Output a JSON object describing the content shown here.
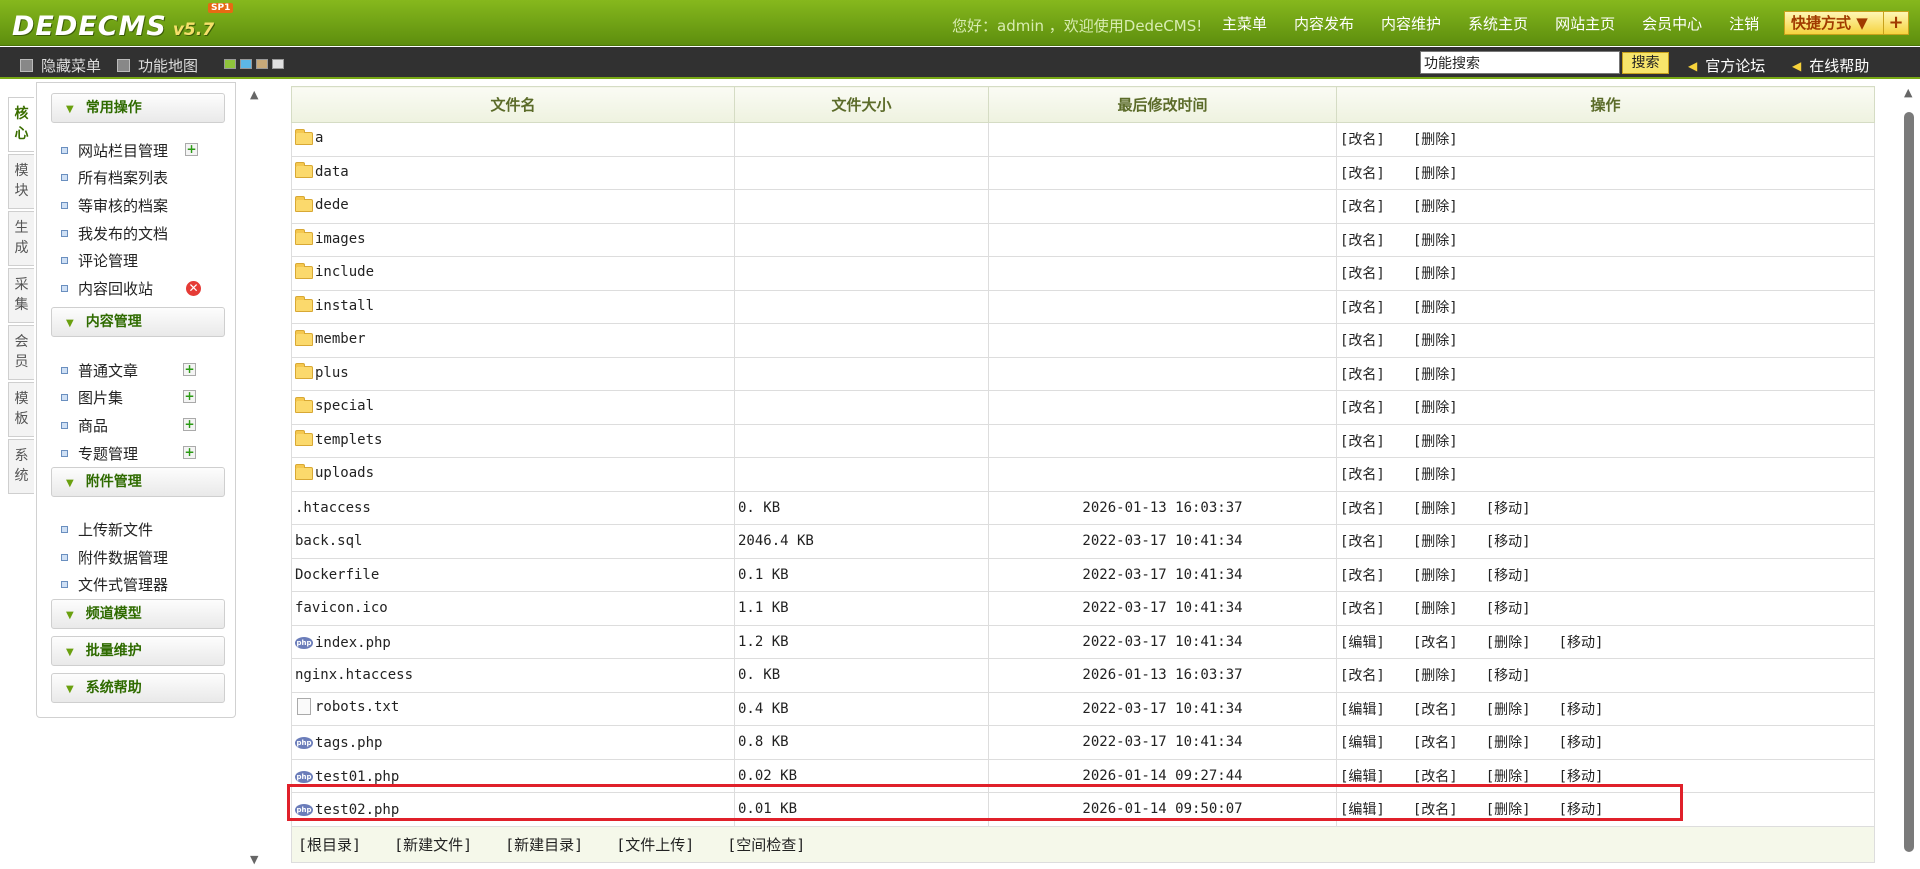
{
  "header": {
    "logo_text": "DEDECMS",
    "version": "v5.7",
    "sp_badge": "SP1",
    "greeting": "您好：admin ，欢迎使用DedeCMS!",
    "nav": [
      "主菜单",
      "内容发布",
      "内容维护",
      "系统主页",
      "网站主页",
      "会员中心",
      "注销"
    ],
    "quick_label": "快捷方式 ▼",
    "quick_plus": "+"
  },
  "subbar": {
    "hide_menu": "隐藏菜单",
    "func_map": "功能地图",
    "search_value": "功能搜索",
    "search_button": "搜索",
    "forum": "官方论坛",
    "help": "在线帮助",
    "skin_colors": [
      "#8fc33b",
      "#5cb7e6",
      "#c7a979",
      "#e0e0e0"
    ]
  },
  "vtabs": [
    "核心",
    "模块",
    "生成",
    "采集",
    "会员",
    "模板",
    "系统"
  ],
  "menu": {
    "groups": [
      {
        "title": "常用操作",
        "items": [
          "网站栏目管理",
          "所有档案列表",
          "等审核的档案",
          "我发布的文档",
          "评论管理",
          "内容回收站"
        ]
      },
      {
        "title": "内容管理",
        "items": [
          "普通文章",
          "图片集",
          "商品",
          "专题管理"
        ]
      },
      {
        "title": "附件管理",
        "items": [
          "上传新文件",
          "附件数据管理",
          "文件式管理器"
        ]
      },
      {
        "title": "频道模型",
        "items": []
      },
      {
        "title": "批量维护",
        "items": []
      },
      {
        "title": "系统帮助",
        "items": []
      }
    ]
  },
  "table": {
    "headers": [
      "文件名",
      "文件大小",
      "最后修改时间",
      "操作"
    ],
    "rows": [
      {
        "name": "a",
        "type": "folder",
        "size": "",
        "time": "",
        "actions": [
          "[改名]",
          "[删除]"
        ]
      },
      {
        "name": "data",
        "type": "folder",
        "size": "",
        "time": "",
        "actions": [
          "[改名]",
          "[删除]"
        ]
      },
      {
        "name": "dede",
        "type": "folder",
        "size": "",
        "time": "",
        "actions": [
          "[改名]",
          "[删除]"
        ]
      },
      {
        "name": "images",
        "type": "folder",
        "size": "",
        "time": "",
        "actions": [
          "[改名]",
          "[删除]"
        ]
      },
      {
        "name": "include",
        "type": "folder",
        "size": "",
        "time": "",
        "actions": [
          "[改名]",
          "[删除]"
        ]
      },
      {
        "name": "install",
        "type": "folder",
        "size": "",
        "time": "",
        "actions": [
          "[改名]",
          "[删除]"
        ]
      },
      {
        "name": "member",
        "type": "folder",
        "size": "",
        "time": "",
        "actions": [
          "[改名]",
          "[删除]"
        ]
      },
      {
        "name": "plus",
        "type": "folder",
        "size": "",
        "time": "",
        "actions": [
          "[改名]",
          "[删除]"
        ]
      },
      {
        "name": "special",
        "type": "folder",
        "size": "",
        "time": "",
        "actions": [
          "[改名]",
          "[删除]"
        ]
      },
      {
        "name": "templets",
        "type": "folder",
        "size": "",
        "time": "",
        "actions": [
          "[改名]",
          "[删除]"
        ]
      },
      {
        "name": "uploads",
        "type": "folder",
        "size": "",
        "time": "",
        "actions": [
          "[改名]",
          "[删除]"
        ]
      },
      {
        "name": ".htaccess",
        "type": "plain",
        "size": "0. KB",
        "time": "2026-01-13 16:03:37",
        "actions": [
          "[改名]",
          "[删除]",
          "[移动]"
        ]
      },
      {
        "name": "back.sql",
        "type": "plain",
        "size": "2046.4 KB",
        "time": "2022-03-17 10:41:34",
        "actions": [
          "[改名]",
          "[删除]",
          "[移动]"
        ]
      },
      {
        "name": "Dockerfile",
        "type": "plain",
        "size": "0.1 KB",
        "time": "2022-03-17 10:41:34",
        "actions": [
          "[改名]",
          "[删除]",
          "[移动]"
        ]
      },
      {
        "name": "favicon.ico",
        "type": "plain",
        "size": "1.1 KB",
        "time": "2022-03-17 10:41:34",
        "actions": [
          "[改名]",
          "[删除]",
          "[移动]"
        ]
      },
      {
        "name": "index.php",
        "type": "php",
        "size": "1.2 KB",
        "time": "2022-03-17 10:41:34",
        "actions": [
          "[编辑]",
          "[改名]",
          "[删除]",
          "[移动]"
        ]
      },
      {
        "name": "nginx.htaccess",
        "type": "plain",
        "size": "0. KB",
        "time": "2026-01-13 16:03:37",
        "actions": [
          "[改名]",
          "[删除]",
          "[移动]"
        ]
      },
      {
        "name": "robots.txt",
        "type": "txt",
        "size": "0.4 KB",
        "time": "2022-03-17 10:41:34",
        "actions": [
          "[编辑]",
          "[改名]",
          "[删除]",
          "[移动]"
        ]
      },
      {
        "name": "tags.php",
        "type": "php",
        "size": "0.8 KB",
        "time": "2022-03-17 10:41:34",
        "actions": [
          "[编辑]",
          "[改名]",
          "[删除]",
          "[移动]"
        ]
      },
      {
        "name": "test01.php",
        "type": "php",
        "size": "0.02 KB",
        "time": "2026-01-14 09:27:44",
        "actions": [
          "[编辑]",
          "[改名]",
          "[删除]",
          "[移动]"
        ]
      },
      {
        "name": "test02.php",
        "type": "php",
        "size": "0.01 KB",
        "time": "2026-01-14 09:50:07",
        "actions": [
          "[编辑]",
          "[改名]",
          "[删除]",
          "[移动]"
        ]
      }
    ],
    "footer_links": [
      "[根目录]",
      "[新建文件]",
      "[新建目录]",
      "[文件上传]",
      "[空间检查]"
    ],
    "php_icon_label": "php"
  }
}
